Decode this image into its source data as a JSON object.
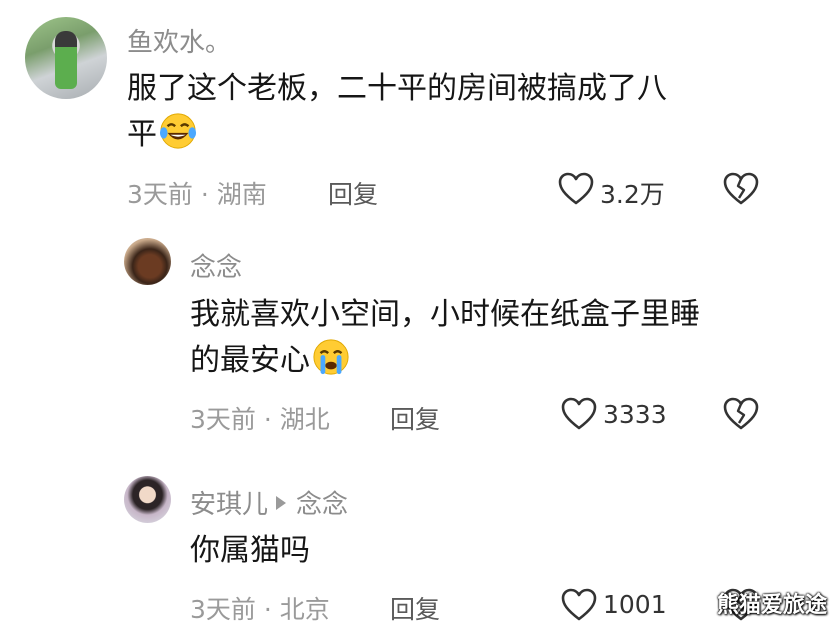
{
  "comments": [
    {
      "username": "鱼欢水。",
      "text_line1": "服了这个老板，二十平的房间被搞成了八",
      "text_line2": "平",
      "emoji": "laughing-crying-emoji",
      "meta": "3天前 · 湖南",
      "reply_label": "回复",
      "likes": "3.2万"
    },
    {
      "username": "念念",
      "text_line1": "我就喜欢小空间，小时候在纸盒子里睡",
      "text_line2": "的最安心",
      "emoji": "crying-emoji",
      "meta": "3天前 · 湖北",
      "reply_label": "回复",
      "likes": "3333"
    },
    {
      "username": "安琪儿",
      "reply_to": "念念",
      "text_line1": "你属猫吗",
      "meta": "3天前 · 北京",
      "reply_label": "回复",
      "likes": "1001"
    }
  ],
  "watermark": "熊猫爱旅途",
  "colors": {
    "text": "#161616",
    "muted": "#9a9a9a",
    "name": "#8c8c8c"
  }
}
